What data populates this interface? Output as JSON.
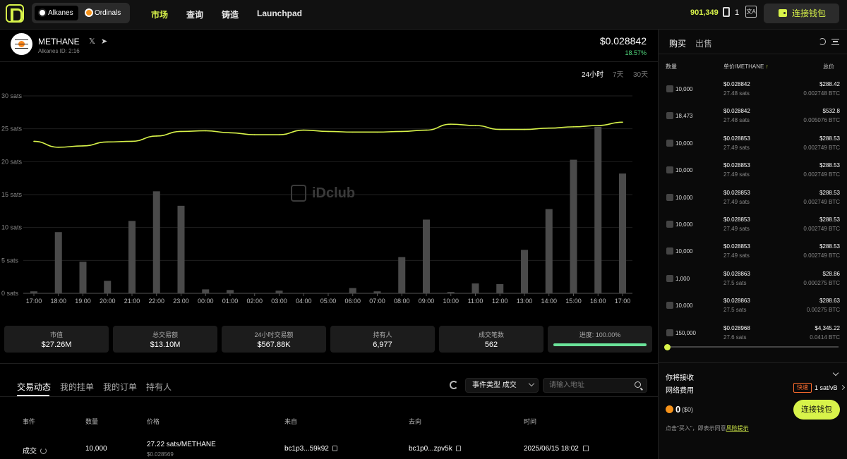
{
  "header": {
    "protocols": [
      "Alkanes",
      "Ordinals"
    ],
    "nav": [
      "市场",
      "查询",
      "铸造",
      "Launchpad"
    ],
    "block_height": "901,349",
    "gas_level": "1",
    "connect_label": "连接钱包"
  },
  "token": {
    "name": "METHANE",
    "id_label": "Alkanes ID: 2:16",
    "price": "$0.028842",
    "change": "18.57%"
  },
  "timeframes": [
    "24小时",
    "7天",
    "30天"
  ],
  "chart_data": {
    "type": "bar+line",
    "categories": [
      "17:00",
      "18:00",
      "19:00",
      "20:00",
      "21:00",
      "22:00",
      "23:00",
      "00:00",
      "01:00",
      "02:00",
      "03:00",
      "04:00",
      "05:00",
      "06:00",
      "07:00",
      "08:00",
      "09:00",
      "10:00",
      "11:00",
      "12:00",
      "13:00",
      "14:00",
      "15:00",
      "16:00",
      "17:00"
    ],
    "y_ticks": [
      "30 sats",
      "25 sats",
      "20 sats",
      "15 sats",
      "10 sats",
      "5 sats",
      "0 sats"
    ],
    "ylim": [
      0,
      30
    ],
    "bars": [
      0.3,
      9.3,
      4.8,
      1.9,
      11,
      15.5,
      13.3,
      0.6,
      0.5,
      0,
      0.4,
      0,
      0,
      0.8,
      0.3,
      5.5,
      11.2,
      0.2,
      1.5,
      1.4,
      6.6,
      12.8,
      20.3,
      25.3,
      18.2
    ],
    "line": [
      23.1,
      22.2,
      22.4,
      23.0,
      23.1,
      23.9,
      24.6,
      24.7,
      24.4,
      24.1,
      24.1,
      24.8,
      24.6,
      24.5,
      24.5,
      24.6,
      24.8,
      25.7,
      25.5,
      24.9,
      24.9,
      25.1,
      25.3,
      25.5,
      26.0
    ],
    "grid": true,
    "colors": {
      "bar": "#4a4a4a",
      "line": "#d8f34a"
    }
  },
  "watermark": "iDclub",
  "stats": [
    {
      "label": "市值",
      "value": "$27.26M"
    },
    {
      "label": "总交易额",
      "value": "$13.10M"
    },
    {
      "label": "24小时交易额",
      "value": "$567.88K"
    },
    {
      "label": "持有人",
      "value": "6,977"
    },
    {
      "label": "成交笔数",
      "value": "562"
    },
    {
      "label": "进度: 100.00%",
      "progress": 1.0
    }
  ],
  "activity": {
    "tabs": [
      "交易动态",
      "我的挂单",
      "我的订单",
      "持有人"
    ],
    "filter_label": "事件类型 成交",
    "address_placeholder": "请输入地址",
    "columns": [
      "事件",
      "数量",
      "价格",
      "来自",
      "去向",
      "时间"
    ],
    "rows": [
      {
        "event": "成交",
        "qty": "10,000",
        "price": "27.22 sats/METHANE",
        "price_usd": "$0.028569",
        "from": "bc1p3...59k92",
        "to": "bc1p0...zpv5k",
        "time": "2025/06/15 18:02"
      }
    ]
  },
  "orderbook": {
    "tabs": [
      "购买",
      "出售"
    ],
    "headers": {
      "qty": "数量",
      "unit": "单价/METHANE",
      "total": "总价"
    },
    "rows": [
      {
        "qty": "10,000",
        "price": "$0.028842",
        "sats": "27.48 sats",
        "usd": "$288.42",
        "btc": "0.002748 BTC"
      },
      {
        "qty": "18,473",
        "price": "$0.028842",
        "sats": "27.48 sats",
        "usd": "$532.8",
        "btc": "0.005076 BTC"
      },
      {
        "qty": "10,000",
        "price": "$0.028853",
        "sats": "27.49 sats",
        "usd": "$288.53",
        "btc": "0.002749 BTC"
      },
      {
        "qty": "10,000",
        "price": "$0.028853",
        "sats": "27.49 sats",
        "usd": "$288.53",
        "btc": "0.002749 BTC"
      },
      {
        "qty": "10,000",
        "price": "$0.028853",
        "sats": "27.49 sats",
        "usd": "$288.53",
        "btc": "0.002749 BTC"
      },
      {
        "qty": "10,000",
        "price": "$0.028853",
        "sats": "27.49 sats",
        "usd": "$288.53",
        "btc": "0.002749 BTC"
      },
      {
        "qty": "10,000",
        "price": "$0.028853",
        "sats": "27.49 sats",
        "usd": "$288.53",
        "btc": "0.002749 BTC"
      },
      {
        "qty": "1,000",
        "price": "$0.028863",
        "sats": "27.5 sats",
        "usd": "$28.86",
        "btc": "0.000275 BTC"
      },
      {
        "qty": "10,000",
        "price": "$0.028863",
        "sats": "27.5 sats",
        "usd": "$288.63",
        "btc": "0.00275 BTC"
      },
      {
        "qty": "150,000",
        "price": "$0.028968",
        "sats": "27.6 sats",
        "usd": "$4,345.22",
        "btc": "0.0414 BTC"
      }
    ],
    "receive_label": "你将接收",
    "net_fee_label": "网络费用",
    "fee_speed": "快速",
    "fee_rate": "1 sat/vB",
    "receive_amount": "0",
    "receive_usd": "($0)",
    "connect_label": "连接钱包",
    "risk_note": "点击\"买入\"，即表示同意",
    "risk_link": "风险提示"
  }
}
